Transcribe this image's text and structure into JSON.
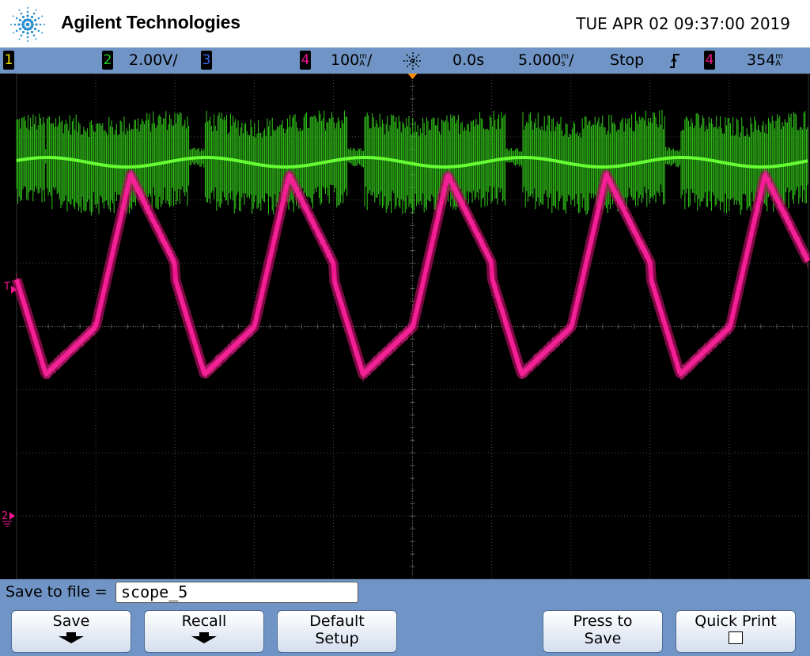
{
  "header": {
    "brand": "Agilent Technologies",
    "datetime": "TUE APR 02 09:37:00 2019"
  },
  "status_bar": {
    "ch1_badge": "1",
    "ch2_badge": "2",
    "ch2_scale": "2.00V/",
    "ch3_badge": "3",
    "ch4_badge": "4",
    "ch4_scale_value": "100",
    "ch4_scale_unit_top": "m",
    "ch4_scale_unit_bottom": "A",
    "ch4_scale_suffix": "/",
    "trigger_position_icon": "trigger-position-icon",
    "time_delay": "0.0s",
    "time_scale_value": "5.000",
    "time_scale_unit_top": "m",
    "time_scale_unit_bottom": "s",
    "time_scale_suffix": "/",
    "run_state": "Stop",
    "trigger_slope_icon": "rising-edge-icon",
    "trigger_source_badge": "4",
    "trigger_level_value": "354",
    "trigger_level_unit_top": "m",
    "trigger_level_unit_bottom": "A"
  },
  "colors": {
    "ch1": "#f5e600",
    "ch2": "#21d021",
    "ch3": "#3b6bf0",
    "ch4": "#f0168f",
    "ch2_trace": "#33cc1a",
    "ch2_mean_trace": "#66ff33",
    "grid": "#4a4a4a",
    "trigger_marker": "#ff8c00",
    "panel_blue": "#6f94c5"
  },
  "markers": {
    "trigger_level_label": "T",
    "ground_label": "2"
  },
  "save_bar": {
    "label": "Save to file =",
    "filename": "scope_5"
  },
  "softkeys": {
    "save": "Save",
    "recall": "Recall",
    "default_setup_line1": "Default",
    "default_setup_line2": "Setup",
    "press_to_save_line1": "Press to",
    "press_to_save_line2": "Save",
    "quick_print": "Quick Print"
  }
}
